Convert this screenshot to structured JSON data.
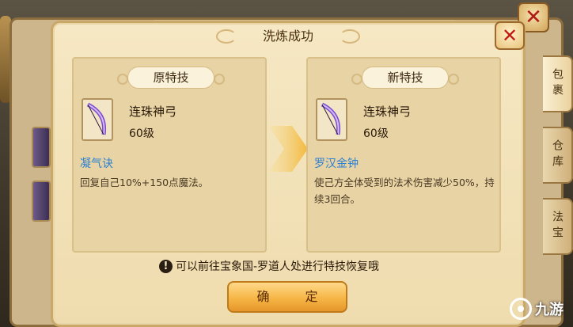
{
  "background": {
    "bag_title": "包 裹",
    "side_tabs": [
      {
        "label": "包裹",
        "active": true
      },
      {
        "label": "仓库",
        "active": false
      },
      {
        "label": "法宝",
        "active": false
      }
    ]
  },
  "modal": {
    "title": "洗炼成功",
    "close_icon": "close-icon",
    "original": {
      "header": "原特技",
      "item_name": "连珠神弓",
      "item_level": "60级",
      "skill_name": "凝气诀",
      "skill_desc": "回复自己10%+150点魔法。"
    },
    "new": {
      "header": "新特技",
      "item_name": "连珠神弓",
      "item_level": "60级",
      "skill_name": "罗汉金钟",
      "skill_desc": "使己方全体受到的法术伤害减少50%，持续3回合。"
    },
    "tip": "可以前往宝象国-罗道人处进行特技恢复哦",
    "confirm_label": "确 定"
  },
  "watermark": "九游",
  "colors": {
    "skill_name": "#2d7fd1",
    "close_x": "#c2190f",
    "confirm_bg": "#f6b646",
    "panel_bg": "#e8d3a4",
    "modal_bg": "#f6e8c4"
  }
}
